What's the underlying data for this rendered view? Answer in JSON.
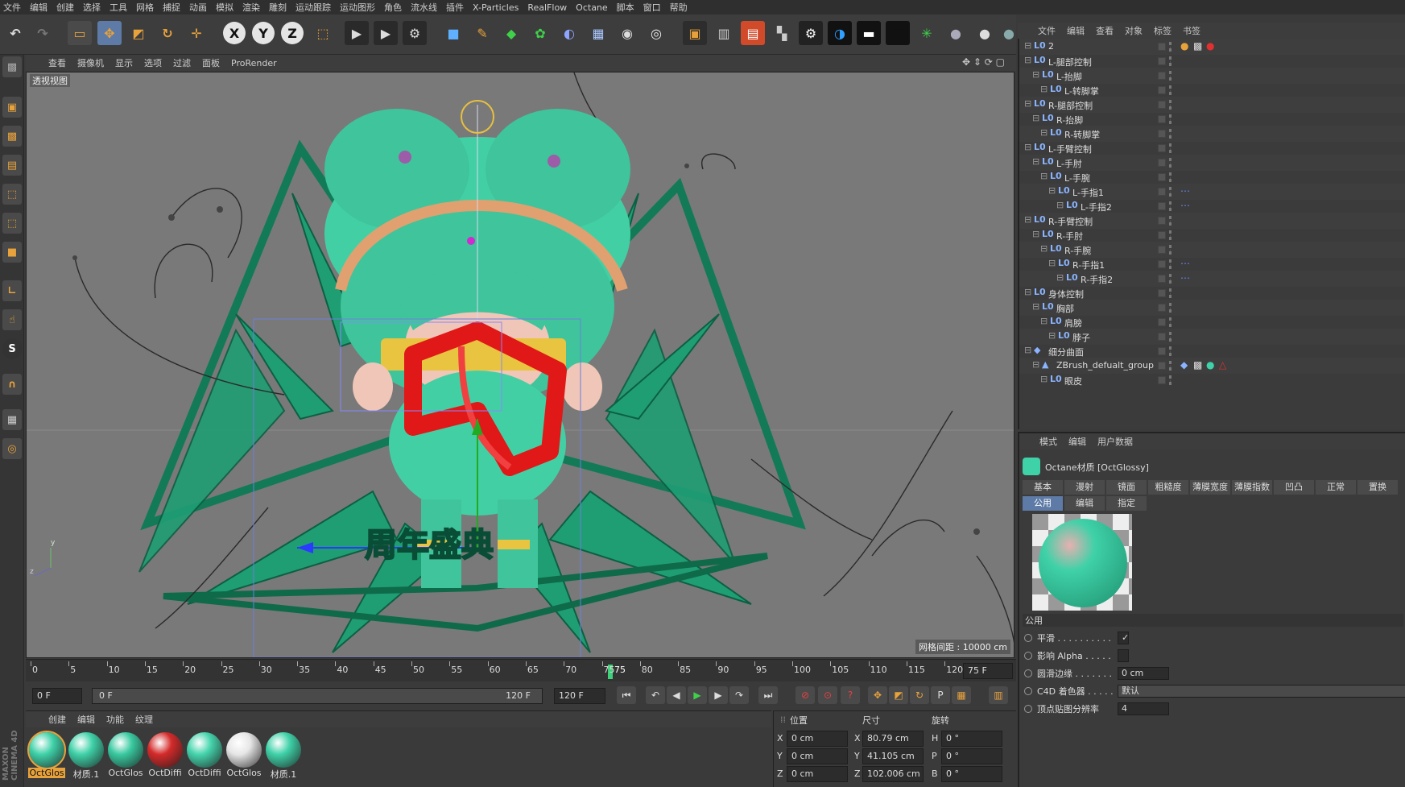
{
  "menubar": [
    "文件",
    "编辑",
    "创建",
    "选择",
    "工具",
    "网格",
    "捕捉",
    "动画",
    "模拟",
    "渲染",
    "雕刻",
    "运动跟踪",
    "运动图形",
    "角色",
    "流水线",
    "插件",
    "X-Particles",
    "RealFlow",
    "Octane",
    "脚本",
    "窗口",
    "帮助"
  ],
  "viewport": {
    "menu": [
      "查看",
      "摄像机",
      "显示",
      "选项",
      "过滤",
      "面板",
      "ProRender"
    ],
    "label": "透视视图",
    "grid_info": "网格间距 : 10000 cm",
    "scene_text": "周年盛典"
  },
  "timeline": {
    "ticks": [
      "0",
      "5",
      "10",
      "15",
      "20",
      "25",
      "30",
      "35",
      "40",
      "45",
      "50",
      "55",
      "60",
      "65",
      "70",
      "75",
      "80",
      "85",
      "90",
      "95",
      "100",
      "105",
      "110",
      "115",
      "120"
    ],
    "current_frame": "75",
    "current_field": "75 F",
    "start_field": "0 F",
    "range_start": "0 F",
    "range_end": "120 F",
    "end_field": "120 F"
  },
  "material_panel": {
    "menu": [
      "创建",
      "编辑",
      "功能",
      "纹理"
    ],
    "materials": [
      {
        "label": "OctGlos",
        "color": "#3fd1a8",
        "selected": true
      },
      {
        "label": "材质.1",
        "color": "#3fd1a8"
      },
      {
        "label": "OctGlos",
        "color": "#39c9a0"
      },
      {
        "label": "OctDiffi",
        "color": "#d42a2a"
      },
      {
        "label": "OctDiffi",
        "color": "#45d4ac"
      },
      {
        "label": "OctGlos",
        "color": "#e6e6e6"
      },
      {
        "label": "材质.1",
        "color": "#3fd1a8"
      }
    ]
  },
  "coord_panel": {
    "headers": [
      "位置",
      "尺寸",
      "旋转"
    ],
    "rows": [
      {
        "axis": "X",
        "pos": "0 cm",
        "size_axis": "X",
        "size": "80.79 cm",
        "rot_axis": "H",
        "rot": "0 °"
      },
      {
        "axis": "Y",
        "pos": "0 cm",
        "size_axis": "Y",
        "size": "41.105 cm",
        "rot_axis": "P",
        "rot": "0 °"
      },
      {
        "axis": "Z",
        "pos": "0 cm",
        "size_axis": "Z",
        "size": "102.006 cm",
        "rot_axis": "B",
        "rot": "0 °"
      }
    ]
  },
  "object_manager": {
    "menu": [
      "文件",
      "编辑",
      "查看",
      "对象",
      "标签",
      "书签"
    ],
    "rows": [
      {
        "name": "2",
        "indent": 0
      },
      {
        "name": "L-腿部控制",
        "indent": 0
      },
      {
        "name": "L-抬脚",
        "indent": 1
      },
      {
        "name": "L-转脚掌",
        "indent": 2
      },
      {
        "name": "R-腿部控制",
        "indent": 0
      },
      {
        "name": "R-抬脚",
        "indent": 1
      },
      {
        "name": "R-转脚掌",
        "indent": 2
      },
      {
        "name": "L-手臂控制",
        "indent": 0
      },
      {
        "name": "L-手肘",
        "indent": 1
      },
      {
        "name": "L-手腕",
        "indent": 2
      },
      {
        "name": "L-手指1",
        "indent": 3
      },
      {
        "name": "L-手指2",
        "indent": 4
      },
      {
        "name": "R-手臂控制",
        "indent": 0
      },
      {
        "name": "R-手肘",
        "indent": 1
      },
      {
        "name": "R-手腕",
        "indent": 2
      },
      {
        "name": "R-手指1",
        "indent": 3
      },
      {
        "name": "R-手指2",
        "indent": 4
      },
      {
        "name": "身体控制",
        "indent": 0
      },
      {
        "name": "胸部",
        "indent": 1
      },
      {
        "name": "肩膀",
        "indent": 2
      },
      {
        "name": "脖子",
        "indent": 3
      },
      {
        "name": "细分曲面",
        "indent": 0
      },
      {
        "name": "ZBrush_defualt_group",
        "indent": 1
      },
      {
        "name": "眼皮",
        "indent": 2
      }
    ]
  },
  "attributes": {
    "menu": [
      "模式",
      "编辑",
      "用户数据"
    ],
    "title": "Octane材质 [OctGlossy]",
    "tabs_row1": [
      "基本",
      "漫射",
      "镜面",
      "粗糙度",
      "薄膜宽度",
      "薄膜指数",
      "凹凸",
      "正常",
      "置换"
    ],
    "tabs_row2": [
      "公用",
      "编辑",
      "指定"
    ],
    "section": "公用",
    "props": [
      {
        "label": "平滑 . . . . . . . . . .",
        "value": "✓"
      },
      {
        "label": "影响 Alpha . . . . .",
        "value": ""
      },
      {
        "label": "圆滑边缘 . . . . . . .",
        "value": "0 cm"
      },
      {
        "label": "C4D 着色器 . . . . .",
        "value": "默认"
      },
      {
        "label": "顶点贴图分辨率",
        "value": "4"
      }
    ]
  },
  "colors": {
    "accent": "#5d7ba6",
    "teal": "#3fd1a8",
    "red": "#d42a2a",
    "orange": "#e8a23c"
  }
}
